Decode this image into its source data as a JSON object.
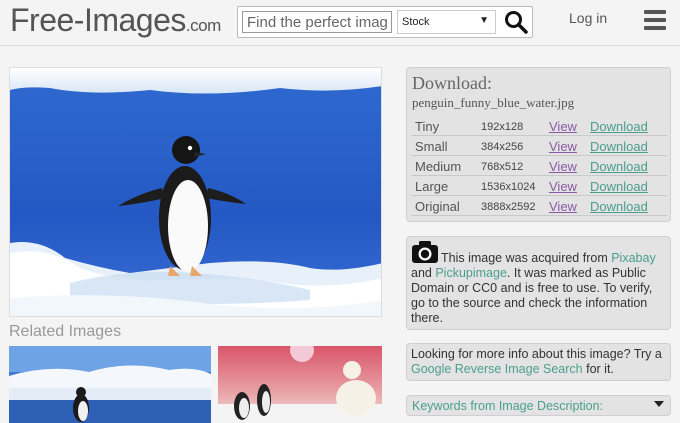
{
  "header": {
    "logo_main": "Free-Images",
    "logo_tld": ".com",
    "search_placeholder": "Find the perfect image",
    "search_category": "Stock",
    "login_label": "Log in"
  },
  "download": {
    "title": "Download:",
    "filename": "penguin_funny_blue_water.jpg",
    "view_label": "View",
    "download_label": "Download",
    "sizes": [
      {
        "name": "Tiny",
        "dims": "192x128"
      },
      {
        "name": "Small",
        "dims": "384x256"
      },
      {
        "name": "Medium",
        "dims": "768x512"
      },
      {
        "name": "Large",
        "dims": "1536x1024"
      },
      {
        "name": "Original",
        "dims": "3888x2592"
      }
    ]
  },
  "license": {
    "text_1": "This image was acquired from",
    "source_1": "Pixabay",
    "and": "and",
    "source_2": "Pickupimage",
    "text_2": ". It was marked as Public Domain or CC0 and is free to use. To verify, go to the source and check the information there."
  },
  "info": {
    "text_1": "Looking for more info about this image? Try a",
    "link": "Google Reverse Image Search",
    "text_2": "for it."
  },
  "keywords": {
    "label": "Keywords from Image Description:"
  },
  "related": {
    "title": "Related Images"
  },
  "icons": {
    "search": "search-icon",
    "menu": "hamburger-menu-icon",
    "camera": "camera-icon",
    "dropdown": "chevron-down-icon"
  },
  "colors": {
    "link_teal": "#4a9e8e",
    "link_visited": "#8a5aa6",
    "panel_bg": "#e3e3e3"
  }
}
